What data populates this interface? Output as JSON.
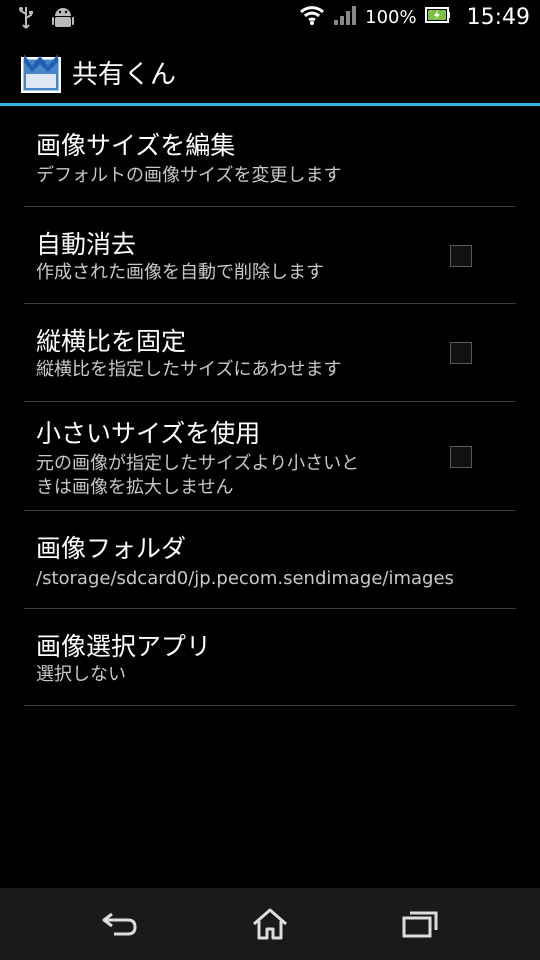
{
  "status_bar": {
    "battery_percent": "100%",
    "time": "15:49",
    "icons": [
      "usb-icon",
      "android-debug-icon",
      "wifi-icon",
      "signal-icon",
      "battery-charging-icon"
    ]
  },
  "action_bar": {
    "title": "共有くん",
    "accent_color": "#33b5e5"
  },
  "preferences": [
    {
      "title": "画像サイズを編集",
      "summary": "デフォルトの画像サイズを変更します"
    },
    {
      "title": "自動消去",
      "summary": "作成された画像を自動で削除します",
      "checked": false
    },
    {
      "title": "縦横比を固定",
      "summary": "縦横比を指定したサイズにあわせます",
      "checked": false
    },
    {
      "title": "小さいサイズを使用",
      "summary": "元の画像が指定したサイズより小さいと\nきは画像を拡大しません",
      "checked": false
    },
    {
      "title": "画像フォルダ",
      "summary": "/storage/sdcard0/jp.pecom.sendimage/images"
    },
    {
      "title": "画像選択アプリ",
      "summary": "選択しない"
    }
  ],
  "nav_bar": {
    "icons": [
      "back-icon",
      "home-icon",
      "recent-apps-icon"
    ]
  }
}
